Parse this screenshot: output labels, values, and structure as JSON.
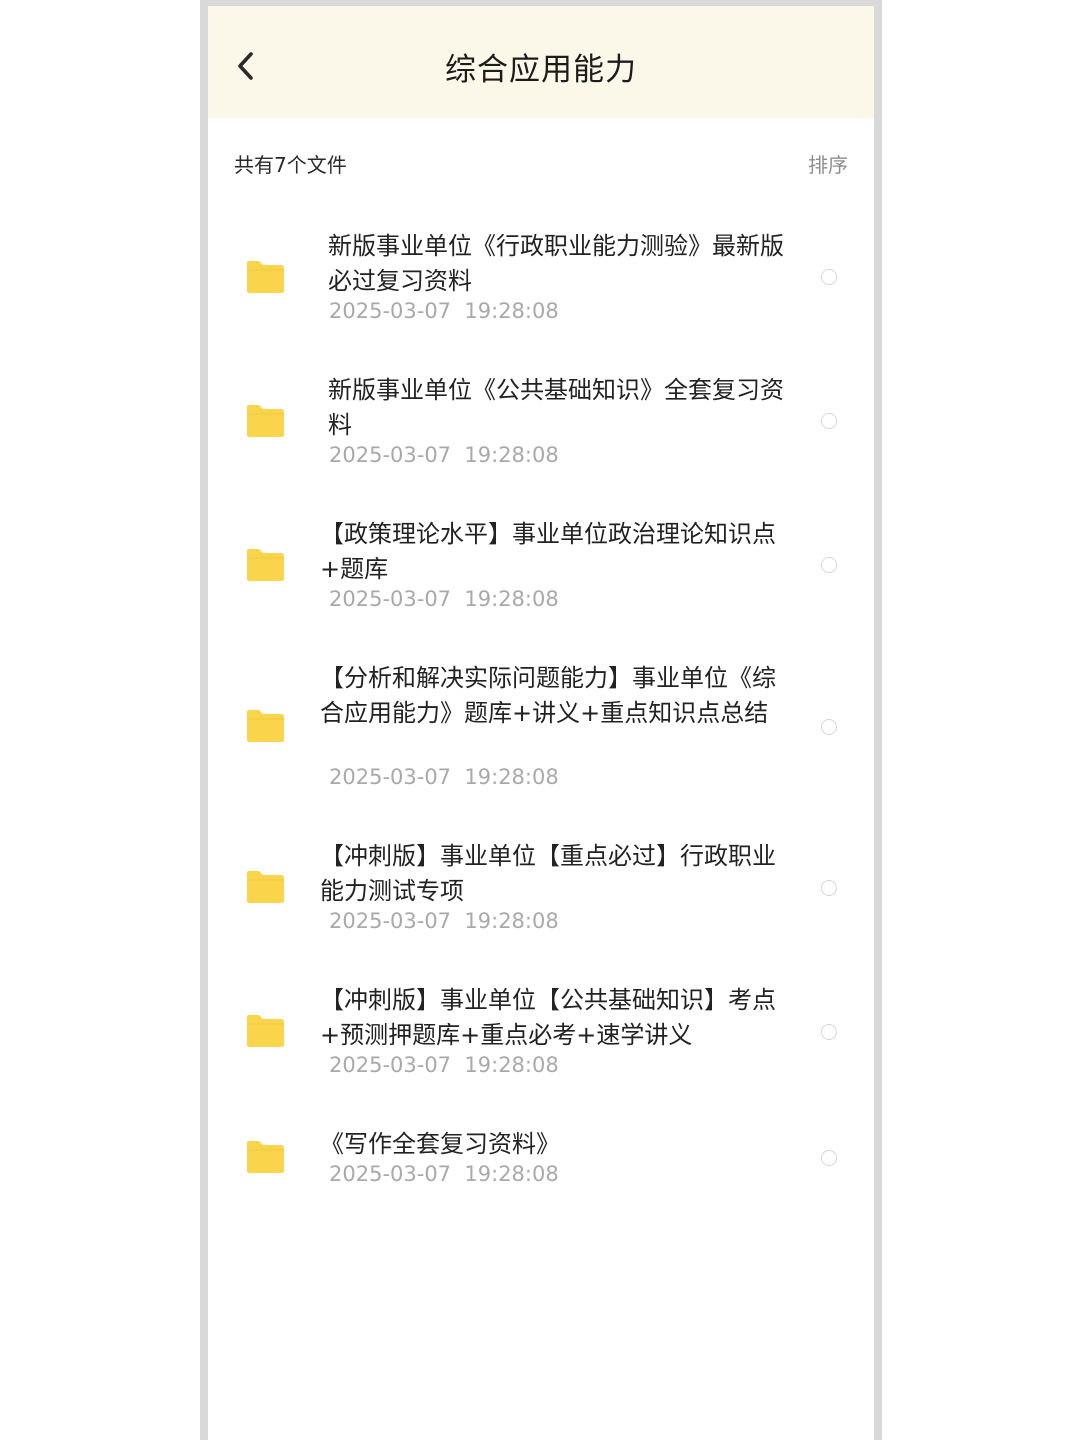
{
  "header": {
    "title": "综合应用能力",
    "back_icon": "chevron-left-icon"
  },
  "summary": {
    "count_text": "共有7个文件",
    "sort_label": "排序"
  },
  "colors": {
    "header_bg": "#fbf7e9",
    "folder": "#fad54c",
    "date_text": "#a9a9a9"
  },
  "files": [
    {
      "title": "新版事业单位《行政职业能力测验》最新版必过复习资料",
      "date": "2025-03-07  19:28:08",
      "icon": "folder-icon",
      "selected": false
    },
    {
      "title": "新版事业单位《公共基础知识》全套复习资料",
      "date": "2025-03-07  19:28:08",
      "icon": "folder-icon",
      "selected": false
    },
    {
      "title": "【政策理论水平】事业单位政治理论知识点+题库",
      "date": "2025-03-07  19:28:08",
      "icon": "folder-icon",
      "selected": false
    },
    {
      "title": "【分析和解决实际问题能力】事业单位《综合应用能力》题库+讲义+重点知识点总结",
      "date": "2025-03-07  19:28:08",
      "icon": "folder-icon",
      "selected": false
    },
    {
      "title": "【冲刺版】事业单位【重点必过】行政职业能力测试专项",
      "date": "2025-03-07  19:28:08",
      "icon": "folder-icon",
      "selected": false
    },
    {
      "title": "【冲刺版】事业单位【公共基础知识】考点+预测押题库+重点必考+速学讲义",
      "date": "2025-03-07  19:28:08",
      "icon": "folder-icon",
      "selected": false
    },
    {
      "title": "《写作全套复习资料》",
      "date": "2025-03-07  19:28:08",
      "icon": "folder-icon",
      "selected": false
    }
  ]
}
